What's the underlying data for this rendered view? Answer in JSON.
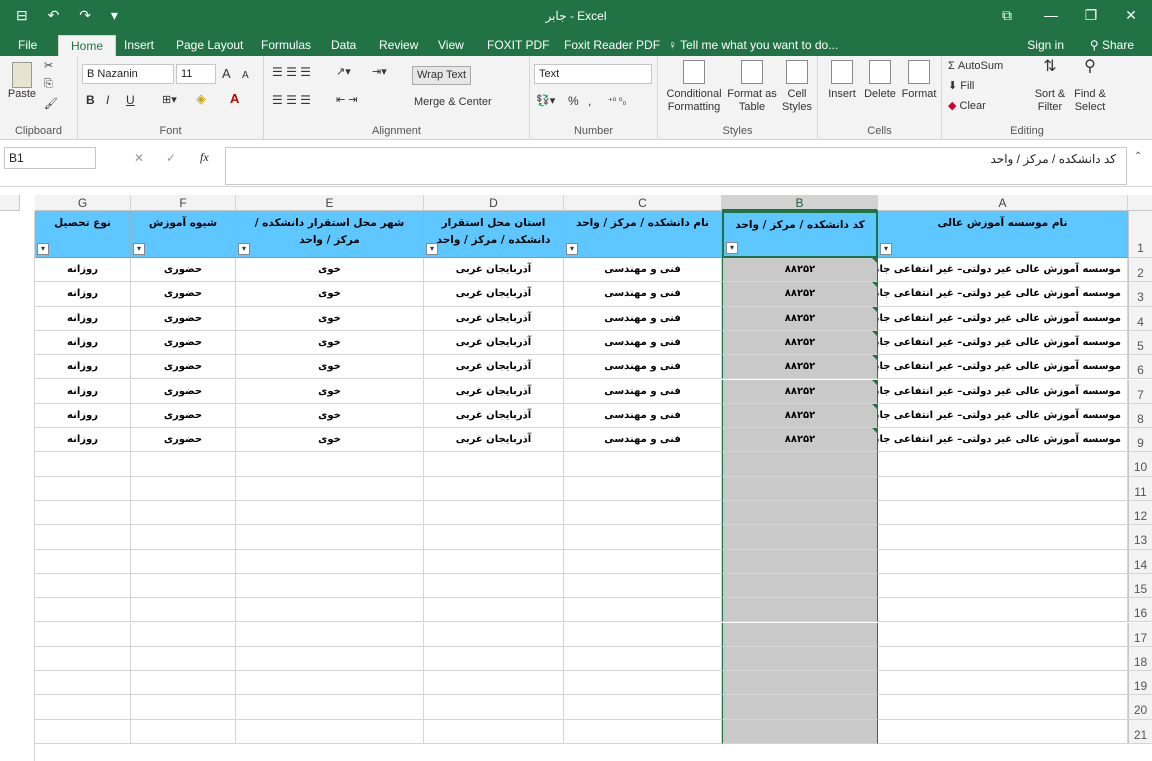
{
  "window": {
    "title": "جابر - Excel",
    "quick_access": "⊟ ↶ ↷ ▾",
    "controls": {
      "ribbon_display": "⧉",
      "minimize": "—",
      "restore": "❐",
      "close": "✕"
    }
  },
  "tabs": [
    "File",
    "Home",
    "Insert",
    "Page Layout",
    "Formulas",
    "Data",
    "Review",
    "View",
    "FOXIT PDF",
    "Foxit Reader PDF"
  ],
  "active_tab": "Home",
  "tell_me": "Tell me what you want to do...",
  "sign_in": "Sign in",
  "share": "Share",
  "ribbon": {
    "clipboard": {
      "label": "Clipboard",
      "paste": "Paste"
    },
    "font": {
      "label": "Font",
      "name": "B Nazanin",
      "size": "11",
      "grow": "A",
      "shrink": "A",
      "bold": "B",
      "italic": "I",
      "underline": "U"
    },
    "alignment": {
      "label": "Alignment",
      "wrap_text": "Wrap Text",
      "merge_center": "Merge & Center"
    },
    "number": {
      "label": "Number",
      "format": "Text",
      "percent": "%",
      "comma": ","
    },
    "styles": {
      "label": "Styles",
      "conditional": "Conditional",
      "conditional_2": "Formatting",
      "format_as": "Format as",
      "format_as_2": "Table",
      "cell": "Cell",
      "cell_2": "Styles"
    },
    "cells": {
      "label": "Cells",
      "insert": "Insert",
      "delete": "Delete",
      "format": "Format"
    },
    "editing": {
      "label": "Editing",
      "autosum": "AutoSum",
      "fill": "Fill",
      "clear": "Clear",
      "sort": "Sort &",
      "sort_2": "Filter",
      "find": "Find &",
      "find_2": "Select"
    }
  },
  "formula_bar": {
    "name_box": "B1",
    "fx": "fx",
    "content": "کد دانشکده / مرکز / واحد"
  },
  "columns": [
    "A",
    "B",
    "C",
    "D",
    "E",
    "F",
    "G"
  ],
  "selected_column": "B",
  "headers": {
    "A": "نام موسسه آموزش عالی",
    "B": "کد دانشکده / مرکز / واحد",
    "C": "نام دانشکده / مرکز / واحد",
    "D": "استان محل استقرار دانشکده / مرکز / واحد",
    "E": "شهر محل استقرار دانشکده / مرکز / واحد",
    "F": "شیوه آموزش",
    "G": "نوع تحصیل"
  },
  "rows": [
    {
      "A": "موسسه آموزش عالی غیر دولتی– غیر انتفاعی جابر",
      "B": "۸۸۲۵۲",
      "C": "فنی و مهندسی",
      "D": "آذربایجان غربی",
      "E": "خوی",
      "F": "حضوری",
      "G": "روزانه"
    },
    {
      "A": "موسسه آموزش عالی غیر دولتی– غیر انتفاعی جابر",
      "B": "۸۸۲۵۲",
      "C": "فنی و مهندسی",
      "D": "آذربایجان غربی",
      "E": "خوی",
      "F": "حضوری",
      "G": "روزانه"
    },
    {
      "A": "موسسه آموزش عالی غیر دولتی– غیر انتفاعی جابر",
      "B": "۸۸۲۵۲",
      "C": "فنی و مهندسی",
      "D": "آذربایجان غربی",
      "E": "خوی",
      "F": "حضوری",
      "G": "روزانه"
    },
    {
      "A": "موسسه آموزش عالی غیر دولتی– غیر انتفاعی جابر",
      "B": "۸۸۲۵۲",
      "C": "فنی و مهندسی",
      "D": "آذربایجان غربی",
      "E": "خوی",
      "F": "حضوری",
      "G": "روزانه"
    },
    {
      "A": "موسسه آموزش عالی غیر دولتی– غیر انتفاعی جابر",
      "B": "۸۸۲۵۲",
      "C": "فنی و مهندسی",
      "D": "آذربایجان غربی",
      "E": "خوی",
      "F": "حضوری",
      "G": "روزانه"
    },
    {
      "A": "موسسه آموزش عالی غیر دولتی– غیر انتفاعی جابر",
      "B": "۸۸۲۵۲",
      "C": "فنی و مهندسی",
      "D": "آذربایجان غربی",
      "E": "خوی",
      "F": "حضوری",
      "G": "روزانه"
    },
    {
      "A": "موسسه آموزش عالی غیر دولتی– غیر انتفاعی جابر",
      "B": "۸۸۲۵۲",
      "C": "فنی و مهندسی",
      "D": "آذربایجان غربی",
      "E": "خوی",
      "F": "حضوری",
      "G": "روزانه"
    },
    {
      "A": "موسسه آموزش عالی غیر دولتی– غیر انتفاعی جابر",
      "B": "۸۸۲۵۲",
      "C": "فنی و مهندسی",
      "D": "آذربایجان غربی",
      "E": "خوی",
      "F": "حضوری",
      "G": "روزانه"
    }
  ],
  "row_numbers": [
    "1",
    "2",
    "3",
    "4",
    "5",
    "6",
    "7",
    "8",
    "9",
    "10",
    "11",
    "12",
    "13",
    "14",
    "15",
    "16",
    "17",
    "18",
    "19",
    "20",
    "21"
  ],
  "colors": {
    "excel_green": "#217346",
    "header_fill": "#5ec7ff",
    "selected_column_fill": "#c9c9c9"
  }
}
